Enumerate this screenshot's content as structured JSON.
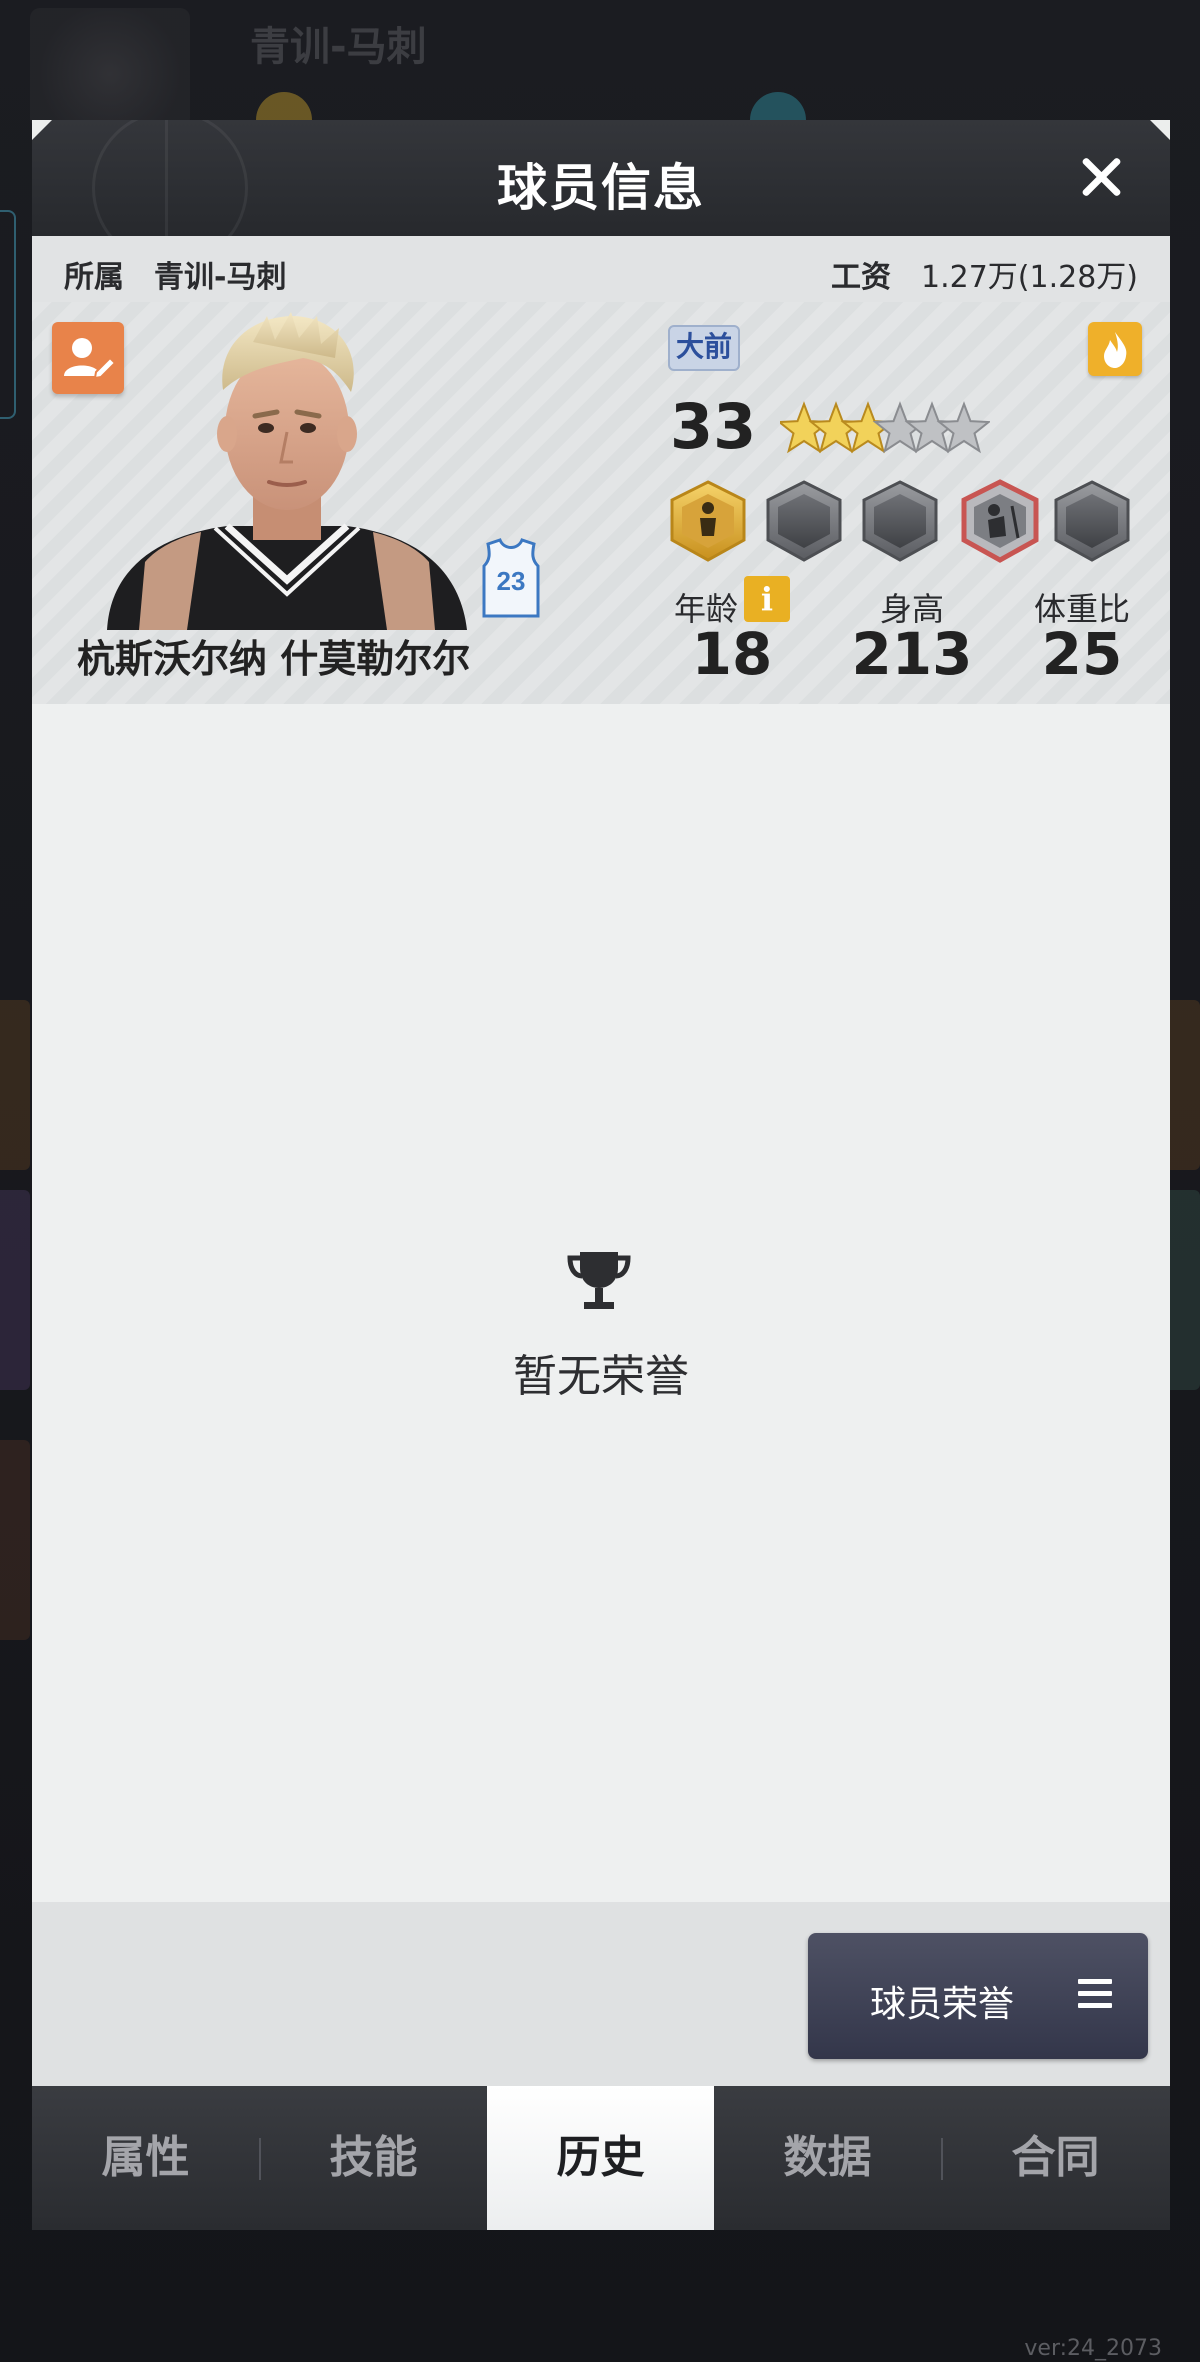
{
  "background": {
    "team_title": "青训-马刺",
    "version": "ver:24_2073"
  },
  "modal": {
    "title": "球员信息",
    "affiliation_label": "所属",
    "affiliation_value": "青训-马刺",
    "salary_label": "工资",
    "salary_value": "1.27万(1.28万)"
  },
  "player": {
    "name": "杭斯沃尔纳 什莫勒尔尔",
    "jersey_number": "23",
    "position": "大前",
    "rating": "33",
    "stars_total": 6,
    "stars_filled": 3,
    "age_label": "年龄",
    "age": "18",
    "height_label": "身高",
    "height": "213",
    "weight_ratio_label": "体重比",
    "weight_ratio": "25"
  },
  "honors": {
    "empty_text": "暂无荣誉",
    "button_label": "球员荣誉"
  },
  "tabs": [
    {
      "label": "属性"
    },
    {
      "label": "技能"
    },
    {
      "label": "历史",
      "active": true
    },
    {
      "label": "数据"
    },
    {
      "label": "合同"
    }
  ],
  "colors": {
    "accent_orange": "#e8834a",
    "gold": "#efb02a",
    "position_blue": "#2c4f9c",
    "header_dark": "#2b2d31"
  }
}
